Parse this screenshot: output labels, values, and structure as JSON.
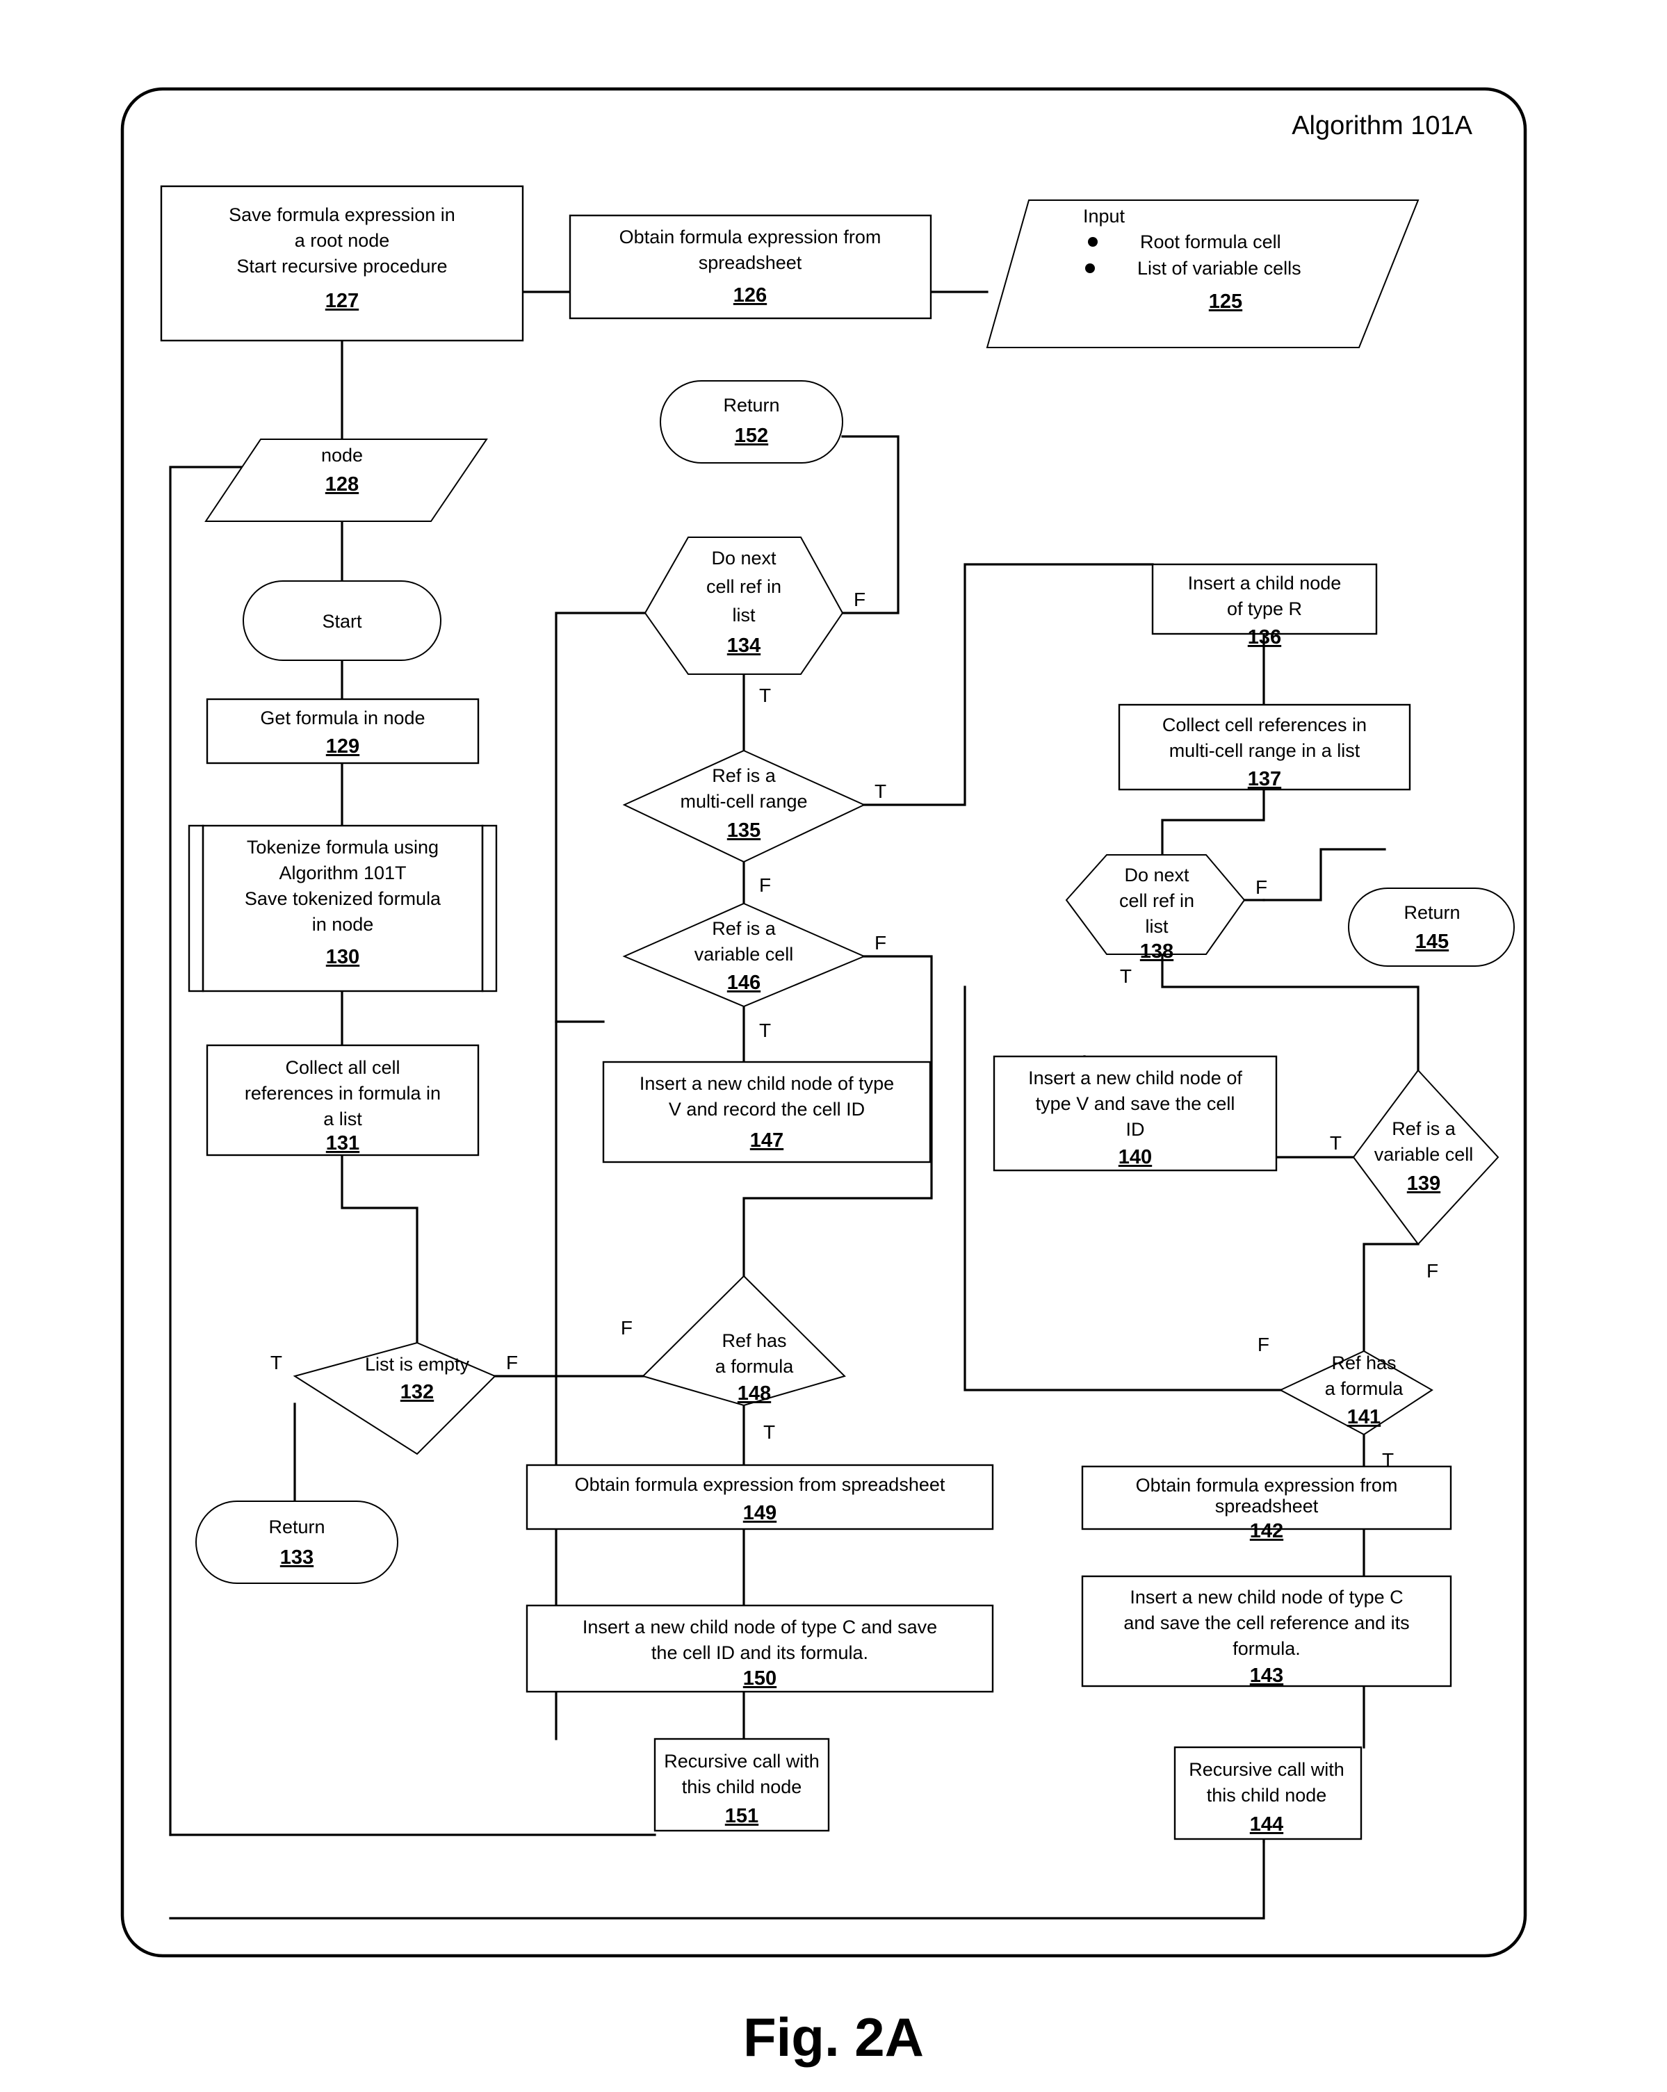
{
  "figure": {
    "title": "Algorithm 101A",
    "caption": "Fig. 2A"
  },
  "edge_labels": {
    "t": "T",
    "f": "F"
  },
  "nodes": {
    "n125": {
      "id": "125",
      "shape": "parallelogram",
      "heading": "Input",
      "bullets": [
        "Root formula cell",
        "List of variable cells"
      ]
    },
    "n126": {
      "id": "126",
      "shape": "process",
      "lines": [
        "Obtain formula expression from",
        "spreadsheet"
      ]
    },
    "n127": {
      "id": "127",
      "shape": "process",
      "lines": [
        "Save  formula expression in",
        "a root node",
        "Start recursive procedure"
      ]
    },
    "n128": {
      "id": "128",
      "shape": "parallelogram",
      "lines": [
        "node"
      ]
    },
    "n_start": {
      "id": "",
      "shape": "terminator",
      "lines": [
        "Start"
      ]
    },
    "n129": {
      "id": "129",
      "shape": "process",
      "lines": [
        "Get formula in node"
      ]
    },
    "n130": {
      "id": "130",
      "shape": "predefined-process",
      "lines": [
        "Tokenize formula using",
        "Algorithm 101T",
        "Save tokenized formula",
        "in node"
      ]
    },
    "n131": {
      "id": "131",
      "shape": "process",
      "lines": [
        "Collect all cell",
        "references in formula in",
        "a list"
      ]
    },
    "n132": {
      "id": "132",
      "shape": "decision",
      "lines": [
        "List is empty"
      ]
    },
    "n133": {
      "id": "133",
      "shape": "terminator",
      "lines": [
        "Return"
      ]
    },
    "n134": {
      "id": "134",
      "shape": "hexagon",
      "lines": [
        "Do next",
        "cell ref in",
        "list"
      ]
    },
    "n135": {
      "id": "135",
      "shape": "decision",
      "lines": [
        "Ref is a",
        "multi-cell range"
      ]
    },
    "n136": {
      "id": "136",
      "shape": "process",
      "lines": [
        "Insert a child node",
        "of type R"
      ]
    },
    "n137": {
      "id": "137",
      "shape": "process",
      "lines": [
        "Collect cell references in",
        "multi-cell range in a list"
      ]
    },
    "n138": {
      "id": "138",
      "shape": "hexagon",
      "lines": [
        "Do next",
        "cell ref in",
        "list"
      ]
    },
    "n139": {
      "id": "139",
      "shape": "decision",
      "lines": [
        "Ref is a",
        "variable cell"
      ]
    },
    "n140": {
      "id": "140",
      "shape": "process",
      "lines": [
        "Insert a new child node of",
        "type V and save the cell",
        "ID"
      ]
    },
    "n141": {
      "id": "141",
      "shape": "decision",
      "lines": [
        "Ref has",
        "a formula"
      ]
    },
    "n142": {
      "id": "142",
      "shape": "process",
      "lines": [
        "Obtain formula expression from",
        "spreadsheet"
      ]
    },
    "n143": {
      "id": "143",
      "shape": "process",
      "lines": [
        "Insert a new child node of type C",
        "and save the cell reference and its",
        "formula."
      ]
    },
    "n144": {
      "id": "144",
      "shape": "process",
      "lines": [
        "Recursive call with",
        "this child node"
      ]
    },
    "n145": {
      "id": "145",
      "shape": "terminator",
      "lines": [
        "Return"
      ]
    },
    "n146": {
      "id": "146",
      "shape": "decision",
      "lines": [
        "Ref is a",
        "variable cell"
      ]
    },
    "n147": {
      "id": "147",
      "shape": "process",
      "lines": [
        "Insert a new child node of type",
        "V and record the cell ID"
      ]
    },
    "n148": {
      "id": "148",
      "shape": "decision",
      "lines": [
        "Ref has",
        "a formula"
      ]
    },
    "n149": {
      "id": "149",
      "shape": "process",
      "lines": [
        "Obtain formula expression from spreadsheet"
      ]
    },
    "n150": {
      "id": "150",
      "shape": "process",
      "lines": [
        "Insert a new child node of type C and save",
        "the cell ID and its formula."
      ]
    },
    "n151": {
      "id": "151",
      "shape": "process",
      "lines": [
        "Recursive call with",
        "this child node"
      ]
    },
    "n152": {
      "id": "152",
      "shape": "terminator",
      "lines": [
        "Return"
      ]
    }
  }
}
